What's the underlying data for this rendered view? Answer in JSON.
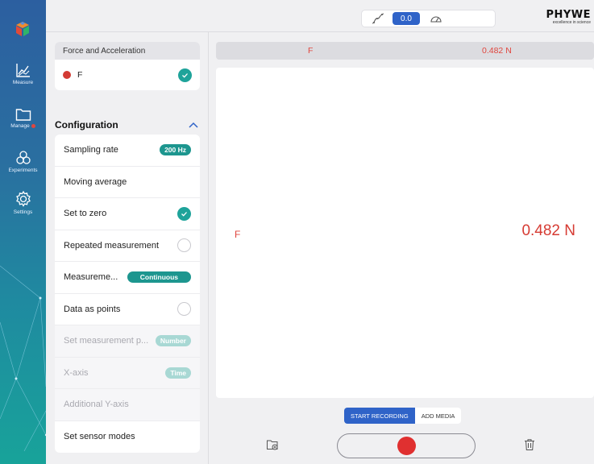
{
  "nav": {
    "items": [
      {
        "label": "Measure",
        "icon": "measure-chart-icon"
      },
      {
        "label": "Manage",
        "icon": "folder-icon",
        "badge": "red-dot"
      },
      {
        "label": "Experiments",
        "icon": "experiments-icon"
      },
      {
        "label": "Settings",
        "icon": "gear-icon"
      }
    ]
  },
  "toolbar": {
    "modes": [
      {
        "name": "graph",
        "icon": "graph-mode-icon"
      },
      {
        "name": "digital",
        "label": "0.0",
        "selected": true
      },
      {
        "name": "gauge",
        "icon": "gauge-mode-icon"
      }
    ],
    "brand": {
      "name": "PHYWE",
      "tagline": "excellence in science"
    }
  },
  "sensor": {
    "header": "Force and Acceleration",
    "channel": {
      "name": "F",
      "color": "#d33b34",
      "checked": true
    }
  },
  "configuration": {
    "title": "Configuration",
    "items": [
      {
        "label": "Sampling rate",
        "badge": "200 Hz",
        "disabled": false
      },
      {
        "label": "Moving average",
        "disabled": false
      },
      {
        "label": "Set to zero",
        "checked": true,
        "disabled": false
      },
      {
        "label": "Repeated measurement",
        "checked": false,
        "disabled": false
      },
      {
        "label": "Measureme...",
        "badge": "Continuous",
        "disabled": false
      },
      {
        "label": "Data as points",
        "checked": false,
        "disabled": false
      },
      {
        "label": "Set measurement p...",
        "badge": "Number",
        "disabled": true
      },
      {
        "label": "X-axis",
        "badge": "Time",
        "disabled": true
      },
      {
        "label": "Additional Y-axis",
        "disabled": true
      },
      {
        "label": "Set sensor modes",
        "disabled": false
      }
    ]
  },
  "channel_bar": {
    "name": "F",
    "value": "0.482 N"
  },
  "display": {
    "name": "F",
    "value": "0.482 N"
  },
  "recording": {
    "tabs": [
      {
        "label": "START RECORDING",
        "selected": true
      },
      {
        "label": "ADD MEDIA",
        "selected": false
      }
    ]
  },
  "colors": {
    "accent": "#2f63c8",
    "teal": "#1d968f",
    "record": "#e03030",
    "value": "#e0463e"
  }
}
